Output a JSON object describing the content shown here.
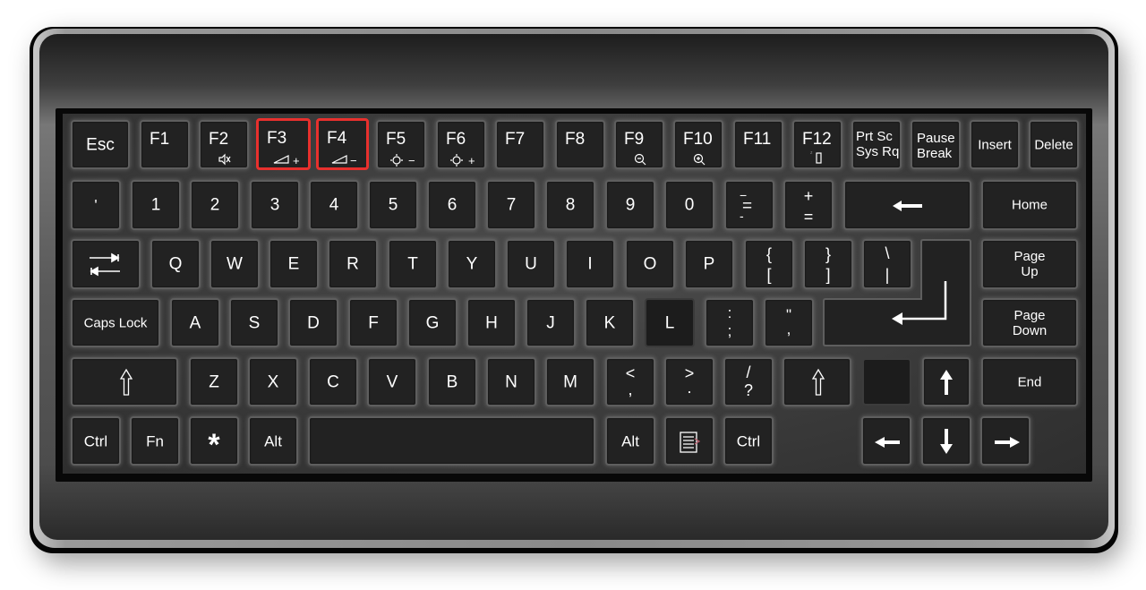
{
  "image": {
    "subject": "Computer keyboard illustration",
    "highlight_color": "#e8302d",
    "key_color": "#222222",
    "label_color": "#ffffff",
    "highlighted_keys": [
      "F3",
      "F4"
    ]
  },
  "rows": {
    "function": {
      "esc": "Esc",
      "f1": "F1",
      "f2": "F2",
      "f2_icon": "mute-icon",
      "f3": "F3",
      "f3_icon": "volume-up-icon",
      "f3_sub": "+",
      "f4": "F4",
      "f4_icon": "volume-down-icon",
      "f4_sub": "−",
      "f5": "F5",
      "f5_icon": "brightness-down-icon",
      "f5_sub": "−",
      "f6": "F6",
      "f6_icon": "brightness-up-icon",
      "f6_sub": "+",
      "f7": "F7",
      "f8": "F8",
      "f9": "F9",
      "f9_icon": "zoom-out-icon",
      "f10": "F10",
      "f10_icon": "zoom-in-icon",
      "f11": "F11",
      "f12": "F12",
      "f12_icon": "sleep-battery-icon",
      "prtsc_1": "Prt Sc",
      "prtsc_2": "Sys Rq",
      "pause_1": "Pause",
      "pause_2": "Break",
      "insert": "Insert",
      "delete": "Delete"
    },
    "number": {
      "backtick": "'",
      "digits": [
        "1",
        "2",
        "3",
        "4",
        "5",
        "6",
        "7",
        "8",
        "9",
        "0"
      ],
      "minus_top": "−",
      "minus_mid": "=",
      "minus_bottom": "-",
      "equals_top": "+",
      "equals_bottom": "=",
      "backspace_icon": "backspace-arrow-icon",
      "home": "Home"
    },
    "top": {
      "tab_icon": "tab-arrows-icon",
      "letters": [
        "Q",
        "W",
        "E",
        "R",
        "T",
        "Y",
        "U",
        "I",
        "O",
        "P"
      ],
      "lbracket_top": "{",
      "lbracket_bottom": "[",
      "rbracket_top": "}",
      "rbracket_bottom": "]",
      "backslash_top": "\\",
      "backslash_bottom": "|",
      "page_up_1": "Page",
      "page_up_2": "Up"
    },
    "home": {
      "caps_lock": "Caps Lock",
      "letters": [
        "A",
        "S",
        "D",
        "F",
        "G",
        "H",
        "J",
        "K",
        "L"
      ],
      "semicolon_top": ":",
      "semicolon_bottom": ";",
      "quote_top": "\"",
      "quote_bottom": ",",
      "enter_icon": "enter-arrow-icon",
      "page_down_1": "Page",
      "page_down_2": "Down"
    },
    "bottom": {
      "shift_icon": "shift-arrow-icon",
      "letters": [
        "Z",
        "X",
        "C",
        "V",
        "B",
        "N",
        "M"
      ],
      "comma_top": "<",
      "comma_bottom": ",",
      "period_top": ">",
      "period_bottom": ".",
      "slash_top": "/",
      "slash_bottom": "?",
      "end": "End"
    },
    "space": {
      "ctrl_left": "Ctrl",
      "fn": "Fn",
      "win": "*",
      "alt_left": "Alt",
      "alt_right": "Alt",
      "menu_icon": "context-menu-icon",
      "ctrl_right": "Ctrl"
    }
  }
}
